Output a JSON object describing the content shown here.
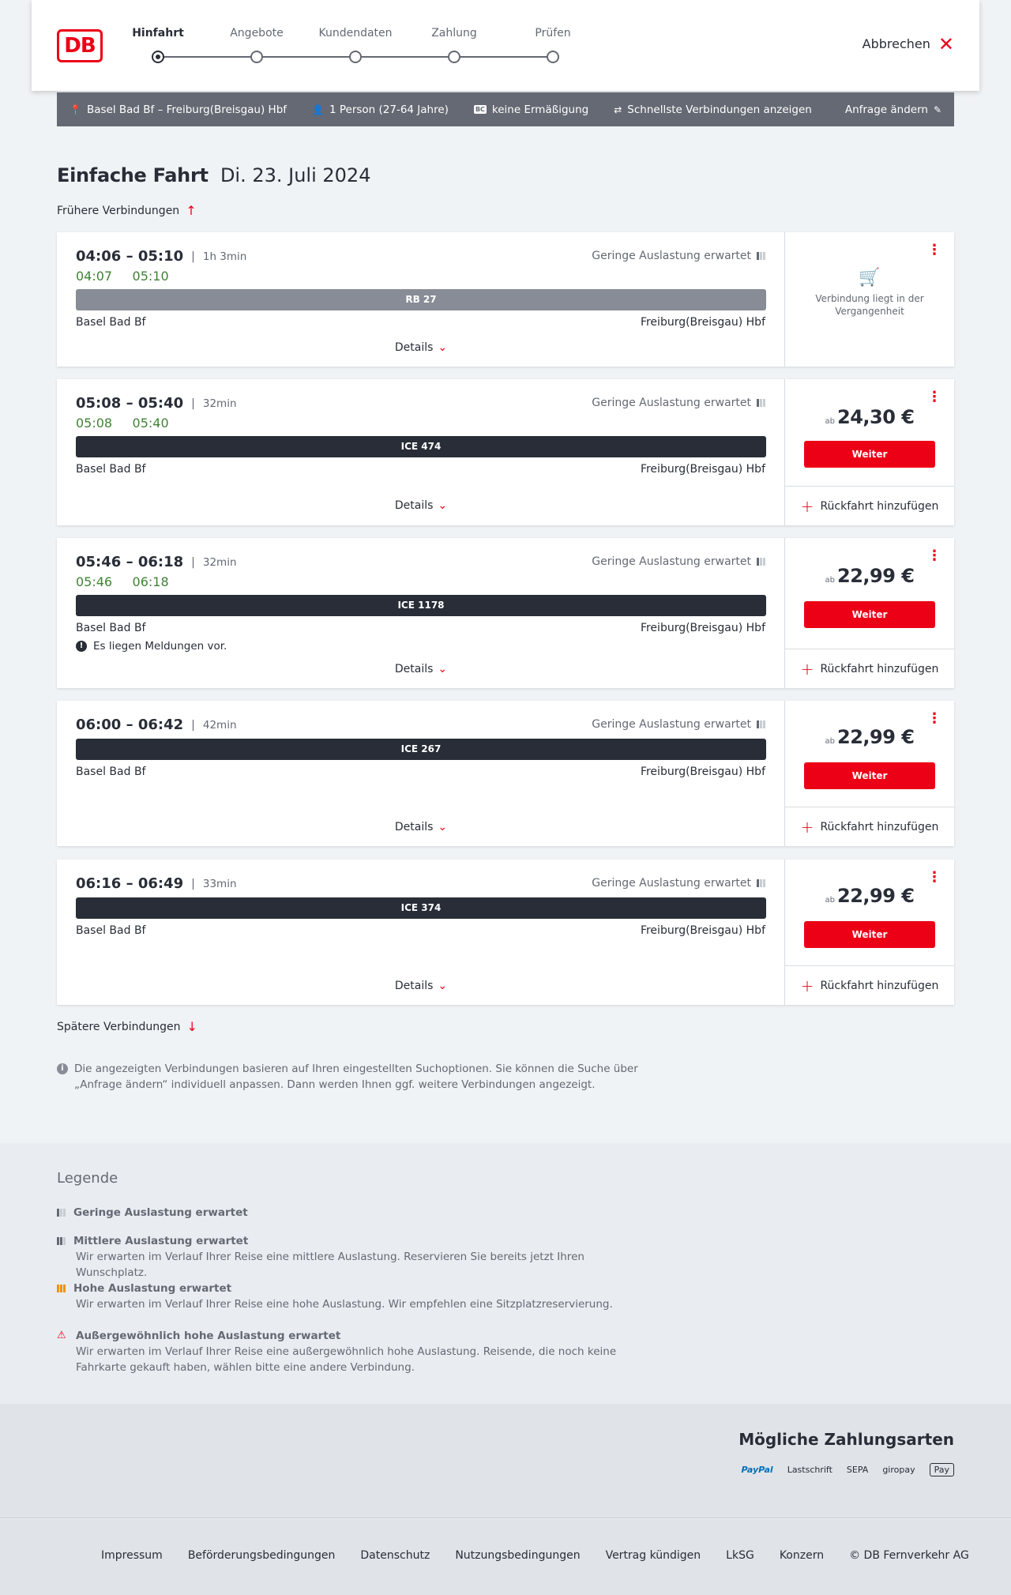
{
  "header": {
    "logo": "DB",
    "abort": "Abbrechen",
    "steps": [
      "Hinfahrt",
      "Angebote",
      "Kundendaten",
      "Zahlung",
      "Prüfen"
    ],
    "active_step": 0
  },
  "search": {
    "route": "Basel Bad Bf – Freiburg(Breisgau) Hbf",
    "persons": "1 Person (27-64 Jahre)",
    "discount_badge": "BC",
    "discount": "keine Ermäßigung",
    "fastest": "Schnellste Verbindungen anzeigen",
    "change": "Anfrage ändern"
  },
  "heading": {
    "title": "Einfache Fahrt",
    "date": "Di. 23. Juli 2024"
  },
  "earlier": "Frühere Verbindungen",
  "later": "Spätere Verbindungen",
  "connections": [
    {
      "dep": "04:06",
      "arr": "05:10",
      "duration": "1h 3min",
      "rt_dep": "04:07",
      "rt_arr": "05:10",
      "load": "Geringe Auslastung erwartet",
      "train": "RB 27",
      "from": "Basel Bad Bf",
      "to": "Freiburg(Breisgau) Hbf",
      "details": "Details",
      "past_text": "Verbindung liegt in der Vergangenheit"
    },
    {
      "dep": "05:08",
      "arr": "05:40",
      "duration": "32min",
      "rt_dep": "05:08",
      "rt_arr": "05:40",
      "load": "Geringe Auslastung erwartet",
      "train": "ICE 474",
      "from": "Basel Bad Bf",
      "to": "Freiburg(Breisgau) Hbf",
      "details": "Details",
      "price_prefix": "ab",
      "price": "24,30 €",
      "cta": "Weiter",
      "return": "Rückfahrt hinzufügen"
    },
    {
      "dep": "05:46",
      "arr": "06:18",
      "duration": "32min",
      "rt_dep": "05:46",
      "rt_arr": "06:18",
      "load": "Geringe Auslastung erwartet",
      "train": "ICE 1178",
      "from": "Basel Bad Bf",
      "to": "Freiburg(Breisgau) Hbf",
      "message": "Es liegen Meldungen vor.",
      "details": "Details",
      "price_prefix": "ab",
      "price": "22,99 €",
      "cta": "Weiter",
      "return": "Rückfahrt hinzufügen"
    },
    {
      "dep": "06:00",
      "arr": "06:42",
      "duration": "42min",
      "load": "Geringe Auslastung erwartet",
      "train": "ICE 267",
      "from": "Basel Bad Bf",
      "to": "Freiburg(Breisgau) Hbf",
      "details": "Details",
      "price_prefix": "ab",
      "price": "22,99 €",
      "cta": "Weiter",
      "return": "Rückfahrt hinzufügen"
    },
    {
      "dep": "06:16",
      "arr": "06:49",
      "duration": "33min",
      "load": "Geringe Auslastung erwartet",
      "train": "ICE 374",
      "from": "Basel Bad Bf",
      "to": "Freiburg(Breisgau) Hbf",
      "details": "Details",
      "price_prefix": "ab",
      "price": "22,99 €",
      "cta": "Weiter",
      "return": "Rückfahrt hinzufügen"
    }
  ],
  "info": "Die angezeigten Verbindungen basieren auf Ihren eingestellten Suchoptionen. Sie können die Suche über „Anfrage ändern“ individuell anpassen. Dann werden Ihnen ggf. weitere Verbindungen angezeigt.",
  "legend": {
    "title": "Legende",
    "items": [
      {
        "title": "Geringe Auslastung erwartet",
        "desc": ""
      },
      {
        "title": "Mittlere Auslastung erwartet",
        "desc": "Wir erwarten im Verlauf Ihrer Reise eine mittlere Auslastung. Reservieren Sie bereits jetzt Ihren Wunschplatz."
      },
      {
        "title": "Hohe Auslastung erwartet",
        "desc": "Wir erwarten im Verlauf Ihrer Reise eine hohe Auslastung. Wir empfehlen eine Sitzplatzreservierung."
      },
      {
        "title": "Außergewöhnlich hohe Auslastung erwartet",
        "desc": "Wir erwarten im Verlauf Ihrer Reise eine außergewöhnlich hohe Auslastung. Reisende, die noch keine Fahrkarte gekauft haben, wählen bitte eine andere Verbindung."
      }
    ]
  },
  "payments": {
    "title": "Mögliche Zahlungsarten",
    "methods": [
      "PayPal",
      "Lastschrift",
      "SEPA",
      "giropay",
      "Pay"
    ]
  },
  "footer": {
    "links": [
      "Impressum",
      "Beförderungsbedingungen",
      "Datenschutz",
      "Nutzungsbedingungen",
      "Vertrag kündigen",
      "LkSG",
      "Konzern",
      "© DB Fernverkehr AG"
    ]
  },
  "colors": {
    "brand": "#ec0016",
    "realtime": "#408335",
    "dark": "#282d37"
  }
}
